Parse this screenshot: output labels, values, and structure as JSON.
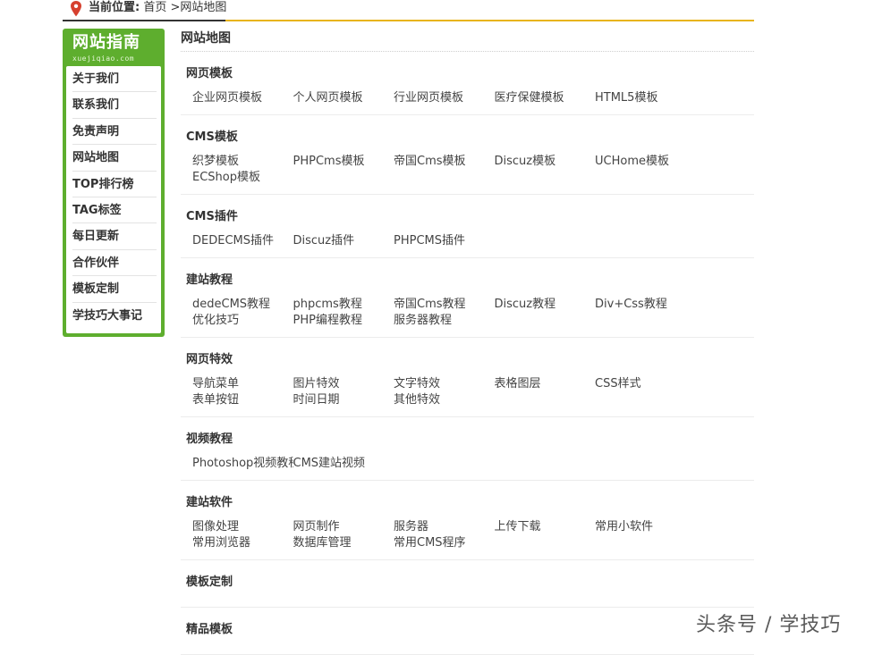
{
  "breadcrumb": {
    "label": "当前位置:",
    "home": "首页",
    "separator": " >",
    "current": "网站地图"
  },
  "sidebar": {
    "title": "网站指南",
    "subtitle": "xuejiqiao.com",
    "items": [
      "关于我们",
      "联系我们",
      "免责声明",
      "网站地图",
      "TOP排行榜",
      "TAG标签",
      "每日更新",
      "合作伙伴",
      "模板定制",
      "学技巧大事记"
    ]
  },
  "main": {
    "title": "网站地图",
    "sections": [
      {
        "title": "网页模板",
        "links": [
          "企业网页模板",
          "个人网页模板",
          "行业网页模板",
          "医疗保健模板",
          "HTML5模板"
        ]
      },
      {
        "title": "CMS模板",
        "links": [
          "织梦模板",
          "PHPCms模板",
          "帝国Cms模板",
          "Discuz模板",
          "UCHome模板",
          "ECShop模板"
        ]
      },
      {
        "title": "CMS插件",
        "links": [
          "DEDECMS插件",
          "Discuz插件",
          "PHPCMS插件"
        ]
      },
      {
        "title": "建站教程",
        "links": [
          "dedeCMS教程",
          "phpcms教程",
          "帝国Cms教程",
          "Discuz教程",
          "Div+Css教程",
          "优化技巧",
          "PHP编程教程",
          "服务器教程"
        ]
      },
      {
        "title": "网页特效",
        "links": [
          "导航菜单",
          "图片特效",
          "文字特效",
          "表格图层",
          "CSS样式",
          "表单按钮",
          "时间日期",
          "其他特效"
        ]
      },
      {
        "title": "视频教程",
        "links": [
          "Photoshop视频教程",
          "CMS建站视频"
        ]
      },
      {
        "title": "建站软件",
        "links": [
          "图像处理",
          "网页制作",
          "服务器",
          "上传下载",
          "常用小软件",
          "常用浏览器",
          "数据库管理",
          "常用CMS程序"
        ]
      },
      {
        "title": "模板定制",
        "links": []
      },
      {
        "title": "精品模板",
        "links": []
      }
    ]
  },
  "watermark": "头条号 / 学技巧",
  "colors": {
    "accent_green": "#5eae2e",
    "accent_gold": "#e8b418",
    "pin_red": "#d6402f"
  }
}
